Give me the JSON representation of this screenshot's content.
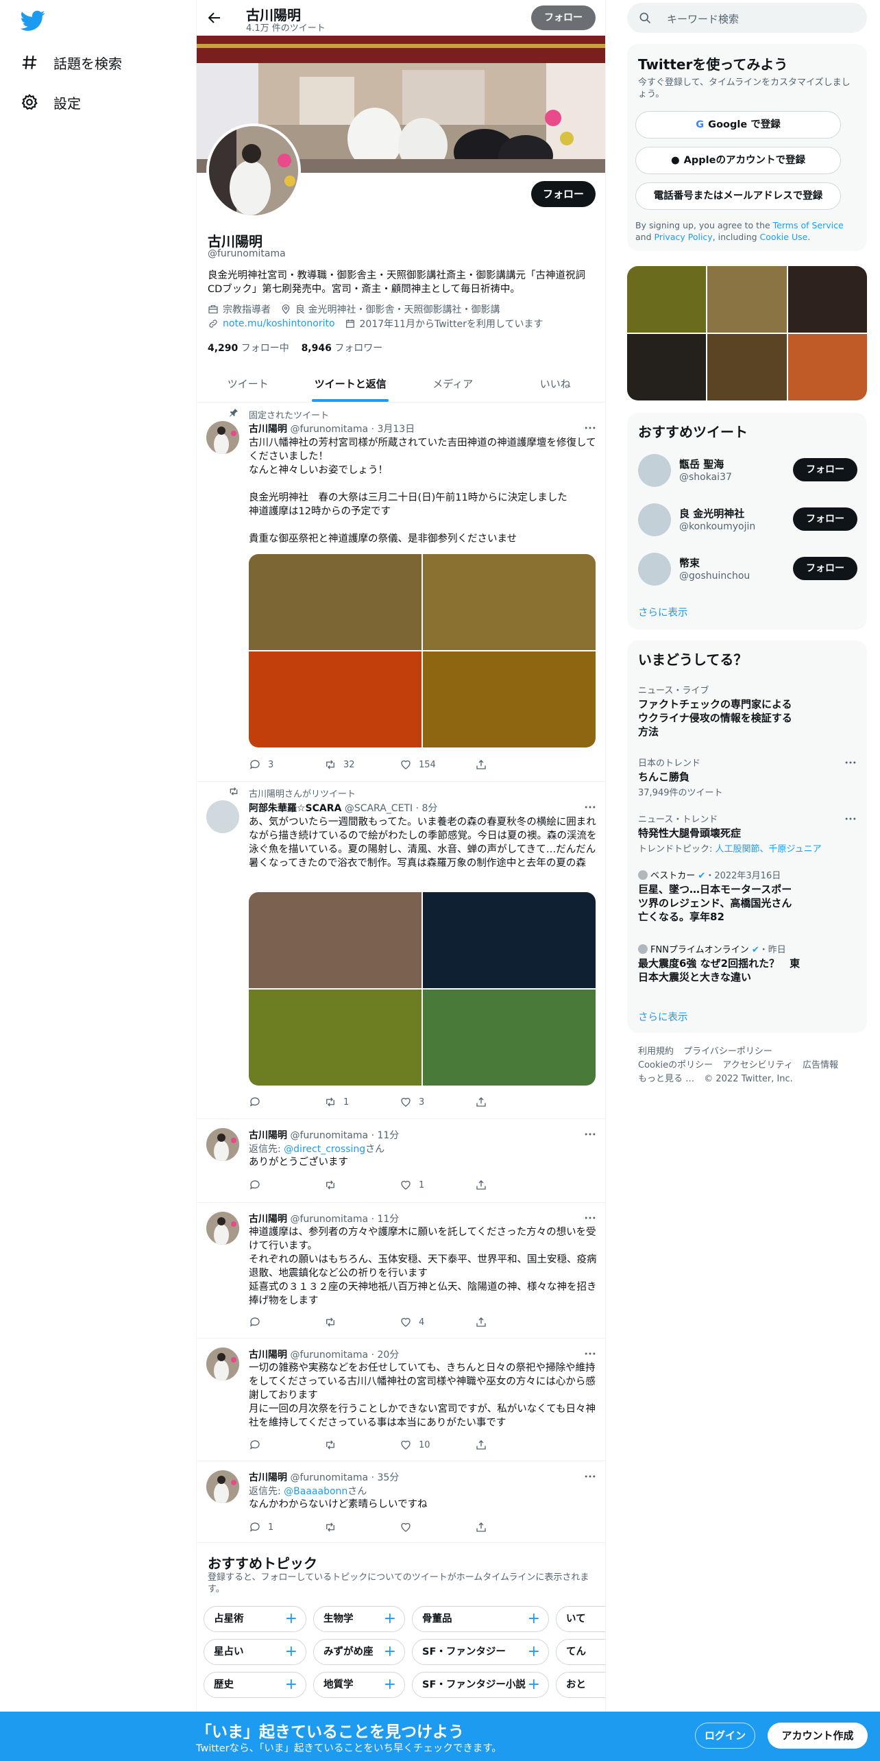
{
  "nav": {
    "logo": "twitter-bird-icon",
    "items": [
      {
        "label": "話題を検索",
        "icon": "hashtag-icon"
      },
      {
        "label": "設定",
        "icon": "gear-icon"
      }
    ]
  },
  "topbar": {
    "name": "古川陽明",
    "tweet_count": "4.1万 件のツイート",
    "follow": "フォロー"
  },
  "profile": {
    "follow": "フォロー",
    "name": "古川陽明",
    "handle": "@furunomitama",
    "bio": "良金光明神社宮司・教導職・御影舎主・天照御影講社斎主・御影講講元「古神道祝詞CDブック」第七刷発売中。宮司・斎主・顧問神主として毎日祈祷中。",
    "category": "宗教指導者",
    "location": "良 金光明神社・御影舎・天照御影講社・御影講",
    "url": "note.mu/koshintonorito",
    "joined": "2017年11月からTwitterを利用しています",
    "following_count": "4,290",
    "following_label": "フォロー中",
    "followers_count": "8,946",
    "followers_label": "フォロワー"
  },
  "tabs": [
    "ツイート",
    "ツイートと返信",
    "メディア",
    "いいね"
  ],
  "active_tab": 1,
  "tweets": [
    {
      "context": "固定されたツイート",
      "name": "古川陽明",
      "handle": "@furunomitama",
      "time": "· 3月13日",
      "body": "古川八幡神社の芳村宮司様が所蔵されていた吉田神道の神道護摩壇を修復してくださいました！\nなんと神々しいお姿でしょう！\n\n良金光明神社　春の大祭は三月二十日(日)午前11時からに決定しました\n神道護摩は12時からの予定です\n\n貴重な御巫祭祀と神道護摩の祭儀、是非御参列くださいませ",
      "media_colors": [
        "#7c6634",
        "#8a7132",
        "#c23e0a",
        "#8e6510"
      ],
      "reply": "3",
      "retweet": "32",
      "like": "154"
    },
    {
      "context": "古川陽明さんがリツイート",
      "name": "阿部朱華羅☆SCARA",
      "handle": "@SCARA_CETI",
      "time": "· 8分",
      "body": "あ、気がついたら一週間散もってた。いま養老の森の春夏秋冬の横絵に囲まれながら描き続けているので絵がわたしの季節感覚。今日は夏の襖。森の渓流を泳ぐ魚を描いている。夏の陽射し、清風、水音、蝉の声がしてきて…だんだん暑くなってきたので浴衣で制作。写真は森羅万象の制作途中と去年の夏の森",
      "media_colors": [
        "#7b6150",
        "#102033",
        "#6d7e22",
        "#4a7a3a"
      ],
      "reply": "",
      "retweet": "1",
      "like": "3"
    },
    {
      "name": "古川陽明",
      "handle": "@furunomitama",
      "time": "· 11分",
      "reply_prefix": "返信先: ",
      "reply_to": "@direct_crossing",
      "reply_suffix": "さん",
      "body": "ありがとうございます",
      "reply": "",
      "retweet": "",
      "like": "1"
    },
    {
      "name": "古川陽明",
      "handle": "@furunomitama",
      "time": "· 11分",
      "body": "神道護摩は、参列者の方々や護摩木に願いを託してくださった方々の想いを受けて行います。\nそれぞれの願いはもちろん、玉体安穏、天下泰平、世界平和、国土安穏、疫病退散、地震鎮化など公の祈りを行います\n延喜式の３１３２座の天神地祇八百万神と仏天、陰陽道の神、様々な神を招き捧げ物をします",
      "reply": "",
      "retweet": "",
      "like": "4"
    },
    {
      "name": "古川陽明",
      "handle": "@furunomitama",
      "time": "· 20分",
      "body": "一切の雑務や実務などをお任せしていても、きちんと日々の祭祀や掃除や維持をしてくださっている古川八幡神社の宮司様や神職や巫女の方々には心から感謝しております\n月に一回の月次祭を行うことしかできない宮司ですが、私がいなくても日々神社を維持してくださっている事は本当にありがたい事です",
      "reply": "",
      "retweet": "",
      "like": "10"
    },
    {
      "name": "古川陽明",
      "handle": "@furunomitama",
      "time": "· 35分",
      "reply_prefix": "返信先: ",
      "reply_to": "@Baaaabonn",
      "reply_suffix": "さん",
      "body": "なんかわからないけど素晴らしいですね",
      "reply": "1",
      "retweet": "",
      "like": ""
    }
  ],
  "topics": {
    "title": "おすすめトピック",
    "subtitle": "登録すると、フォローしているトピックについてのツイートがホームタイムラインに表示されます。",
    "rows": [
      [
        "占星術",
        "生物学",
        "骨董品",
        "いて"
      ],
      [
        "星占い",
        "みずがめ座",
        "SF・ファンタジー",
        "てん"
      ],
      [
        "歴史",
        "地質学",
        "SF・ファンタジー小説",
        "おと"
      ]
    ]
  },
  "search": {
    "placeholder": "キーワード検索"
  },
  "signup": {
    "title": "Twitterを使ってみよう",
    "subtitle": "今すぐ登録して、タイムラインをカスタマイズしましょう。",
    "google": "Google で登録",
    "apple": "Appleのアカウントで登録",
    "phone": "電話番号またはメールアドレスで登録",
    "terms_pre": "By signing up, you agree to the ",
    "terms": "Terms of Service",
    "and": " and ",
    "privacy": "Privacy Policy",
    "including": ", including ",
    "cookie": "Cookie Use",
    "period": "."
  },
  "photo_colors": [
    "#6b6b1e",
    "#8a7444",
    "#2d231c",
    "#24201c",
    "#5a4424",
    "#c05a26"
  ],
  "recommended": {
    "title": "おすすめツイート",
    "accounts": [
      {
        "name": "甑岳 聖海",
        "handle": "@shokai37"
      },
      {
        "name": "良 金光明神社",
        "handle": "@konkoumyojin"
      },
      {
        "name": "幣束",
        "handle": "@goshuinchou"
      }
    ],
    "follow": "フォロー",
    "more": "さらに表示"
  },
  "trends": {
    "title": "いまどうしてる？",
    "items": [
      {
        "category": "ニュース・ライブ",
        "title": "ファクトチェックの専門家によるウクライナ侵攻の情報を検証する方法"
      },
      {
        "category": "日本のトレンド",
        "title": "ちんこ勝負",
        "sub": "37,949件のツイート"
      },
      {
        "category": "ニュース・トレンド",
        "title": "特発性大腿骨頭壊死症",
        "sub_prefix": "トレンドトピック: ",
        "sub_links": "人工股関節、千原ジュニア"
      },
      {
        "source": "ベストカー",
        "time": "・2022年3月16日",
        "title": "巨星、墜つ…日本モータースポーツ界のレジェンド、高橋国光さん亡くなる。享年82"
      },
      {
        "source": "FNNプライムオンライン",
        "time": "・昨日",
        "title": "最大震度6強 なぜ2回揺れた？　東日本大震災と大きな違い"
      }
    ],
    "more": "さらに表示"
  },
  "footer": {
    "links": [
      "利用規約",
      "プライバシーポリシー",
      "Cookieのポリシー",
      "アクセシビリティ",
      "広告情報",
      "もっと見る …",
      "© 2022 Twitter, Inc."
    ]
  },
  "bottombar": {
    "title": "「いま」起きていることを見つけよう",
    "subtitle": "Twitterなら、「いま」起きていることをいち早くチェックできます。",
    "login": "ログイン",
    "signup": "アカウント作成"
  },
  "colors": {
    "accent": "#1d9bf0",
    "text": "#0f1419",
    "muted": "#536471"
  }
}
